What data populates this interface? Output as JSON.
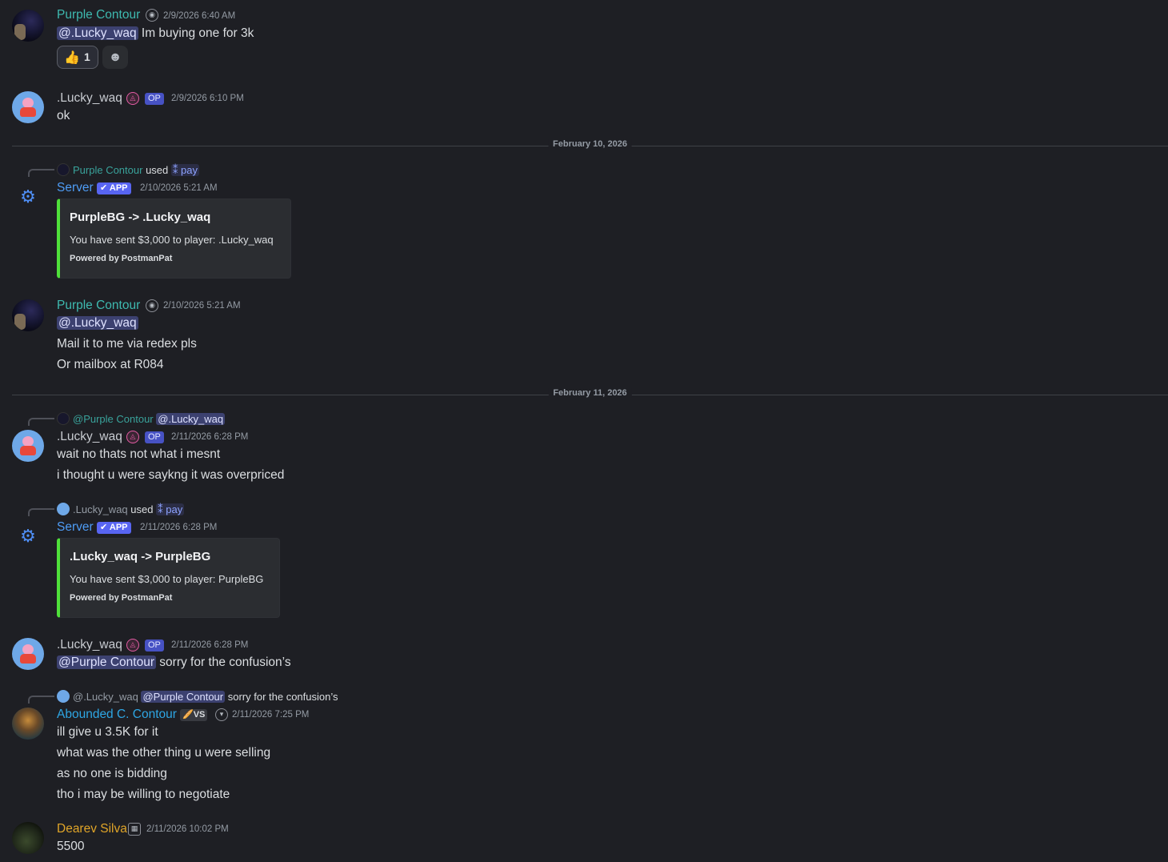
{
  "messages": {
    "m1": {
      "author": "Purple Contour",
      "timestamp": "2/9/2026 6:40 AM",
      "mention": "@.Lucky_waq",
      "text": " Im buying one for 3k",
      "reaction": {
        "emoji": "👍",
        "count": "1"
      }
    },
    "m2": {
      "author": ".Lucky_waq",
      "badge": "OP",
      "timestamp": "2/9/2026 6:10 PM",
      "text": "ok"
    },
    "divider1": "February 10, 2026",
    "m3": {
      "reply_author": "Purple Contour",
      "reply_used": "used",
      "reply_cmd": "pay",
      "author": "Server",
      "badge": "APP",
      "timestamp": "2/10/2026 5:21 AM",
      "embed": {
        "title": "PurpleBG -> .Lucky_waq",
        "desc": "You have sent $3,000 to player: .Lucky_waq",
        "footer": "Powered by PostmanPat"
      }
    },
    "m4": {
      "author": "Purple Contour",
      "timestamp": "2/10/2026 5:21 AM",
      "mention": "@.Lucky_waq",
      "line2": "Mail it to me via redex pls",
      "line3": "Or mailbox at R084"
    },
    "divider2": "February 11, 2026",
    "m5": {
      "reply_author": "@Purple Contour",
      "reply_mention": "@.Lucky_waq",
      "author": ".Lucky_waq",
      "badge": "OP",
      "timestamp": "2/11/2026 6:28 PM",
      "line1": "wait no thats not what i mesnt",
      "line2": "i thought u were saykng it was overpriced"
    },
    "m6": {
      "reply_author": ".Lucky_waq",
      "reply_used": "used",
      "reply_cmd": "pay",
      "author": "Server",
      "badge": "APP",
      "timestamp": "2/11/2026 6:28 PM",
      "embed": {
        "title": ".Lucky_waq -> PurpleBG",
        "desc": "You have sent $3,000 to player: PurpleBG",
        "footer": "Powered by PostmanPat"
      }
    },
    "m7": {
      "author": ".Lucky_waq",
      "badge": "OP",
      "timestamp": "2/11/2026 6:28 PM",
      "mention": "@Purple Contour",
      "text": " sorry for the confusion’s"
    },
    "m8": {
      "reply_author": "@.Lucky_waq",
      "reply_mention": "@Purple Contour",
      "reply_text": " sorry for the confusion’s",
      "author": "Abounded C. Contour",
      "tag": "VS",
      "timestamp": "2/11/2026 7:25 PM",
      "line1": "ill give u 3.5K for it",
      "line2": "what was the other thing u were selling",
      "line3": "as no one is bidding",
      "line4": "tho i may be willing to negotiate"
    },
    "m9": {
      "author": "Dearev Silva",
      "timestamp": "2/11/2026 10:02 PM",
      "text": "5500"
    }
  },
  "colors": {
    "background": "#1e1f24",
    "purple_name": "#3ebab0",
    "server_name": "#4e9cf5",
    "abounded_name": "#2ea6e4",
    "dearev_name": "#e0a528",
    "embed_accent": "#4fe03a"
  },
  "icons": {
    "server_avatar": "gear-icon",
    "add_reaction": "smile-icon",
    "op_ring": "role-icon",
    "app_check": "check-icon"
  }
}
